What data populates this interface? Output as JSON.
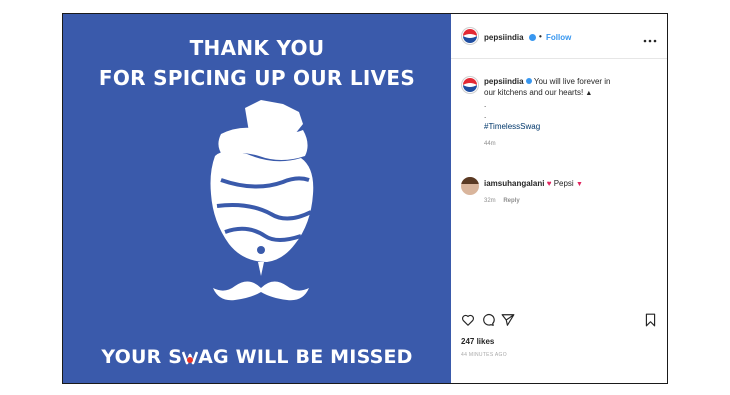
{
  "post_image": {
    "headline_line1": "THANK YOU",
    "headline_line2": "FOR SPICING UP OUR LIVES",
    "tagline_part1": "YOUR S",
    "tagline_part2": "AG WILL BE MISSED",
    "background_color": "#3a5aab"
  },
  "header": {
    "username": "pepsiindia",
    "separator": "•",
    "follow_label": "Follow",
    "more_icon": "more-horizontal-icon"
  },
  "caption": {
    "username": "pepsiindia",
    "text_line1": "You will live forever in",
    "text_line2": "our kitchens and our hearts!",
    "dot1": ".",
    "dot2": ".",
    "hashtag": "#TimelessSwag",
    "time": "44m"
  },
  "comments": [
    {
      "username": "iamsuhangalani",
      "text": "Pepsi",
      "time": "32m",
      "reply_label": "Reply"
    }
  ],
  "actions": {
    "like_icon": "heart-icon",
    "comment_icon": "comment-icon",
    "share_icon": "share-icon",
    "save_icon": "bookmark-icon"
  },
  "likes": "247 likes",
  "date": "44 MINUTES AGO"
}
